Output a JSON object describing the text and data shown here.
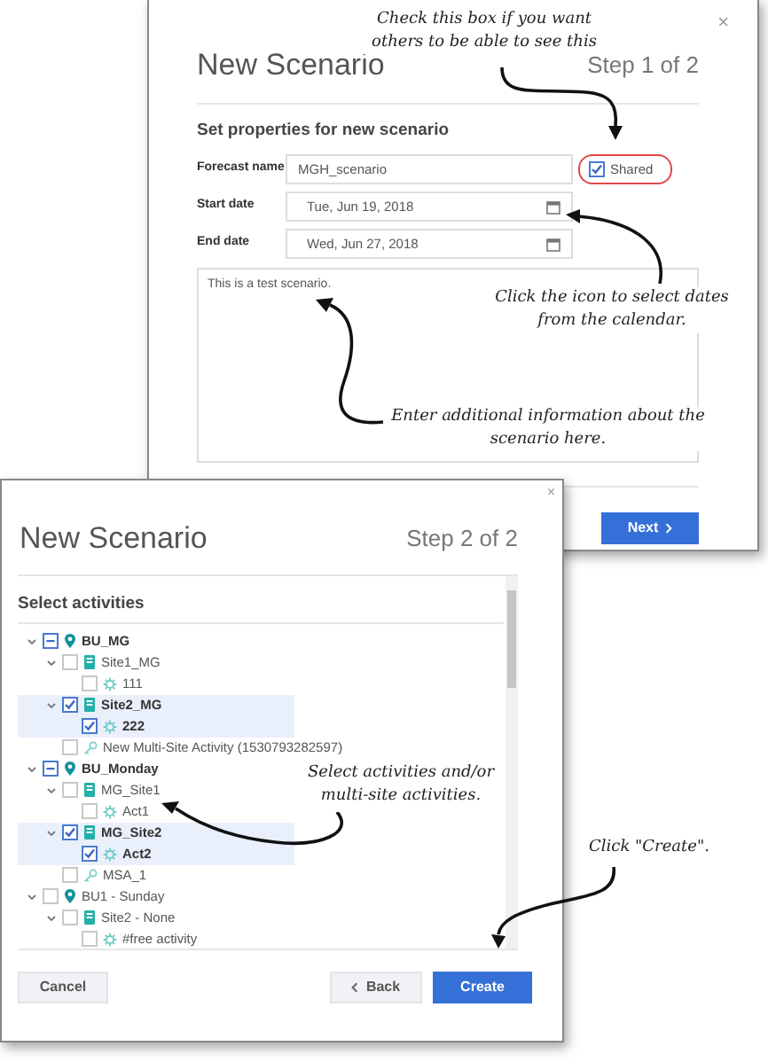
{
  "step1_dialog": {
    "close": "×",
    "title": "New Scenario",
    "step": "Step 1 of 2",
    "section_title": "Set properties for new scenario",
    "fields": [
      {
        "label": "Forecast name",
        "value": "MGH_scenario",
        "kind": "text"
      },
      {
        "label": "Start date",
        "value": "Tue, Jun 19, 2018",
        "kind": "date"
      },
      {
        "label": "End date",
        "value": "Wed, Jun 27, 2018",
        "kind": "date"
      }
    ],
    "shared": {
      "label": "Shared",
      "checked": true
    },
    "description": "This is a test scenario.",
    "next_button": "Next"
  },
  "step2_dialog": {
    "close": "×",
    "title": "New Scenario",
    "step": "Step 2 of 2",
    "section_title": "Select activities",
    "tree": [
      {
        "label": "BU_MG",
        "kind": "unit",
        "checked": false,
        "indeterminate": true,
        "expanded": true,
        "selected": false,
        "children": [
          {
            "label": "Site1_MG",
            "kind": "site",
            "checked": false,
            "indeterminate": false,
            "expanded": true,
            "selected": false,
            "children": [
              {
                "label": "111",
                "kind": "activity",
                "checked": false,
                "indeterminate": false,
                "selected": false
              }
            ]
          },
          {
            "label": "Site2_MG",
            "kind": "site",
            "checked": true,
            "indeterminate": false,
            "expanded": true,
            "selected": true,
            "children": [
              {
                "label": "222",
                "kind": "activity",
                "checked": true,
                "indeterminate": false,
                "selected": true
              }
            ]
          },
          {
            "label": "New Multi-Site Activity (1530793282597)",
            "kind": "multisite",
            "checked": false,
            "indeterminate": false,
            "selected": false
          }
        ]
      },
      {
        "label": "BU_Monday",
        "kind": "unit",
        "checked": false,
        "indeterminate": true,
        "expanded": true,
        "selected": false,
        "children": [
          {
            "label": "MG_Site1",
            "kind": "site",
            "checked": false,
            "indeterminate": false,
            "expanded": true,
            "selected": false,
            "children": [
              {
                "label": "Act1",
                "kind": "activity",
                "checked": false,
                "indeterminate": false,
                "selected": false
              }
            ]
          },
          {
            "label": "MG_Site2",
            "kind": "site",
            "checked": true,
            "indeterminate": false,
            "expanded": true,
            "selected": true,
            "children": [
              {
                "label": "Act2",
                "kind": "activity",
                "checked": true,
                "indeterminate": false,
                "selected": true
              }
            ]
          },
          {
            "label": "MSA_1",
            "kind": "multisite",
            "checked": false,
            "indeterminate": false,
            "selected": false
          }
        ]
      },
      {
        "label": "BU1 - Sunday",
        "kind": "unit",
        "checked": false,
        "indeterminate": false,
        "expanded": true,
        "selected": false,
        "children": [
          {
            "label": "Site2 - None",
            "kind": "site",
            "checked": false,
            "indeterminate": false,
            "expanded": true,
            "selected": false,
            "children": [
              {
                "label": "#free activity",
                "kind": "activity",
                "checked": false,
                "indeterminate": false,
                "selected": false
              }
            ]
          }
        ]
      }
    ],
    "cancel_button": "Cancel",
    "back_button": "Back",
    "create_button": "Create"
  },
  "annotations": [
    {
      "text": "Check this box if you want others to be able to see this"
    },
    {
      "text": "Click the icon to select dates from the calendar."
    },
    {
      "text": "Enter additional information about the scenario here."
    },
    {
      "text": "Select activities and/or multi-site activities."
    },
    {
      "text": "Click \"Create\"."
    }
  ]
}
